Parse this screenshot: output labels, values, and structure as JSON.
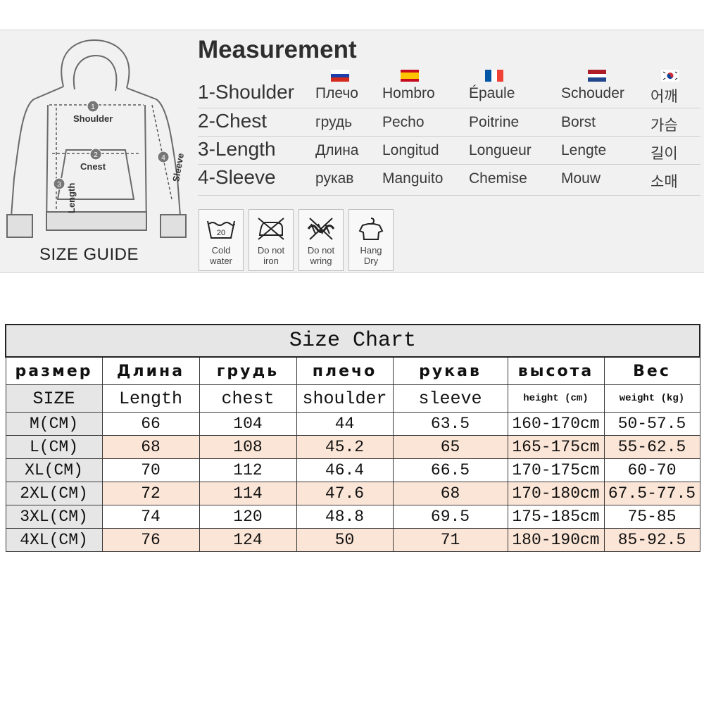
{
  "guide": {
    "title": "Measurement",
    "size_guide_label": "SIZE GUIDE",
    "diagram_labels": {
      "shoulder": "Shoulder",
      "chest": "Cnest",
      "length": "Length",
      "sleeve": "Sleeve",
      "n1": "1",
      "n2": "2",
      "n3": "3",
      "n4": "4"
    },
    "flags": [
      "russia-flag",
      "spain-flag",
      "france-flag",
      "netherlands-flag",
      "korea-flag"
    ],
    "rows": [
      {
        "term": "1-Shoulder",
        "ru": "Плечо",
        "es": "Hombro",
        "fr": "Épaule",
        "nl": "Schouder",
        "ko": "어깨"
      },
      {
        "term": "2-Chest",
        "ru": "грудь",
        "es": "Pecho",
        "fr": "Poitrine",
        "nl": "Borst",
        "ko": "가슴"
      },
      {
        "term": "3-Length",
        "ru": "Длина",
        "es": "Longitud",
        "fr": "Longueur",
        "nl": "Lengte",
        "ko": "길이"
      },
      {
        "term": "4-Sleeve",
        "ru": "рукав",
        "es": "Manguito",
        "fr": "Chemise",
        "nl": "Mouw",
        "ko": "소매"
      }
    ],
    "care": [
      {
        "icon": "cold-water-wash-icon",
        "line1": "Cold",
        "line2": "water",
        "temp": "20"
      },
      {
        "icon": "do-not-iron-icon",
        "line1": "Do not",
        "line2": "iron"
      },
      {
        "icon": "do-not-wring-icon",
        "line1": "Do not",
        "line2": "wring"
      },
      {
        "icon": "hang-dry-icon",
        "line1": "Hang",
        "line2": "Dry"
      }
    ]
  },
  "size_chart": {
    "title": "Size Chart",
    "headers_ru": [
      "размер",
      "Длина",
      "грудь",
      "плечо",
      "рукав",
      "высота",
      "Вес"
    ],
    "headers_en": [
      "SIZE",
      "Length",
      "chest",
      "shoulder",
      "sleeve",
      "height (cm)",
      "weight (kg)"
    ],
    "rows": [
      {
        "size": "M(CM)",
        "length": "66",
        "chest": "104",
        "shoulder": "44",
        "sleeve": "63.5",
        "height": "160-170cm",
        "weight": "50-57.5"
      },
      {
        "size": "L(CM)",
        "length": "68",
        "chest": "108",
        "shoulder": "45.2",
        "sleeve": "65",
        "height": "165-175cm",
        "weight": "55-62.5"
      },
      {
        "size": "XL(CM)",
        "length": "70",
        "chest": "112",
        "shoulder": "46.4",
        "sleeve": "66.5",
        "height": "170-175cm",
        "weight": "60-70"
      },
      {
        "size": "2XL(CM)",
        "length": "72",
        "chest": "114",
        "shoulder": "47.6",
        "sleeve": "68",
        "height": "170-180cm",
        "weight": "67.5-77.5"
      },
      {
        "size": "3XL(CM)",
        "length": "74",
        "chest": "120",
        "shoulder": "48.8",
        "sleeve": "69.5",
        "height": "175-185cm",
        "weight": "75-85"
      },
      {
        "size": "4XL(CM)",
        "length": "76",
        "chest": "124",
        "shoulder": "50",
        "sleeve": "71",
        "height": "180-190cm",
        "weight": "85-92.5"
      }
    ]
  },
  "colors": {
    "row_highlight": "#fbe5d6",
    "label_bg": "#e6e6e6",
    "guide_bg": "#f1f1f1"
  }
}
